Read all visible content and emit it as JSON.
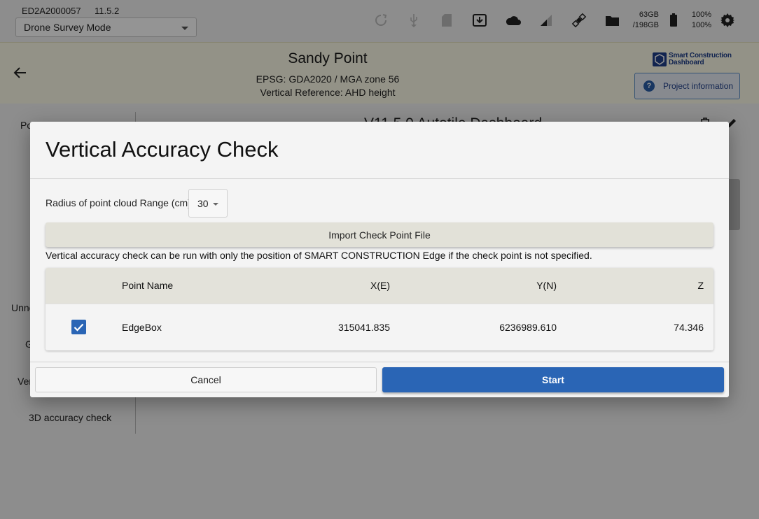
{
  "statusbar": {
    "device_id": "ED2A2000057",
    "version": "11.5.2",
    "mode": "Drone Survey Mode",
    "storage_used": "63GB",
    "storage_total": "/198GB",
    "battery_1": "100%",
    "battery_2": "100%",
    "icons": [
      "refresh-icon",
      "usb-icon",
      "sd-card-icon",
      "download-icon",
      "cloud-icon",
      "signal-icon",
      "satellite-icon",
      "folder-icon",
      "battery-icon",
      "gear-icon"
    ]
  },
  "project": {
    "title": "Sandy Point",
    "epsg": "EPSG: GDA2020 / MGA zone 56",
    "vertical_reference": "Vertical Reference: AHD height",
    "brand_line1": "Smart Construction",
    "brand_line2": "Dashboard",
    "info_button": "Project information"
  },
  "sidebar": {
    "items": [
      "Po",
      "Unne",
      "G",
      "Ver",
      "3D accuracy check"
    ]
  },
  "main": {
    "dashboard_title": "V11.5.0 Autotile Dashboard"
  },
  "dialog": {
    "title": "Vertical Accuracy Check",
    "radius_label": "Radius of point cloud Range (cm)",
    "radius_value": "30",
    "import_button": "Import Check Point File",
    "hint": "Vertical accuracy check can be run with only the position of SMART CONSTRUCTION Edge if the check point is not specified.",
    "table": {
      "headers": [
        "Point Name",
        "X(E)",
        "Y(N)",
        "Z"
      ],
      "rows": [
        {
          "checked": true,
          "name": "EdgeBox",
          "x": "315041.835",
          "y": "6236989.610",
          "z": "74.346"
        }
      ]
    },
    "cancel_button": "Cancel",
    "start_button": "Start"
  },
  "colors": {
    "primary": "#2a65b5",
    "header_bg": "#fdfbe8",
    "brand": "#1f3f8a"
  }
}
